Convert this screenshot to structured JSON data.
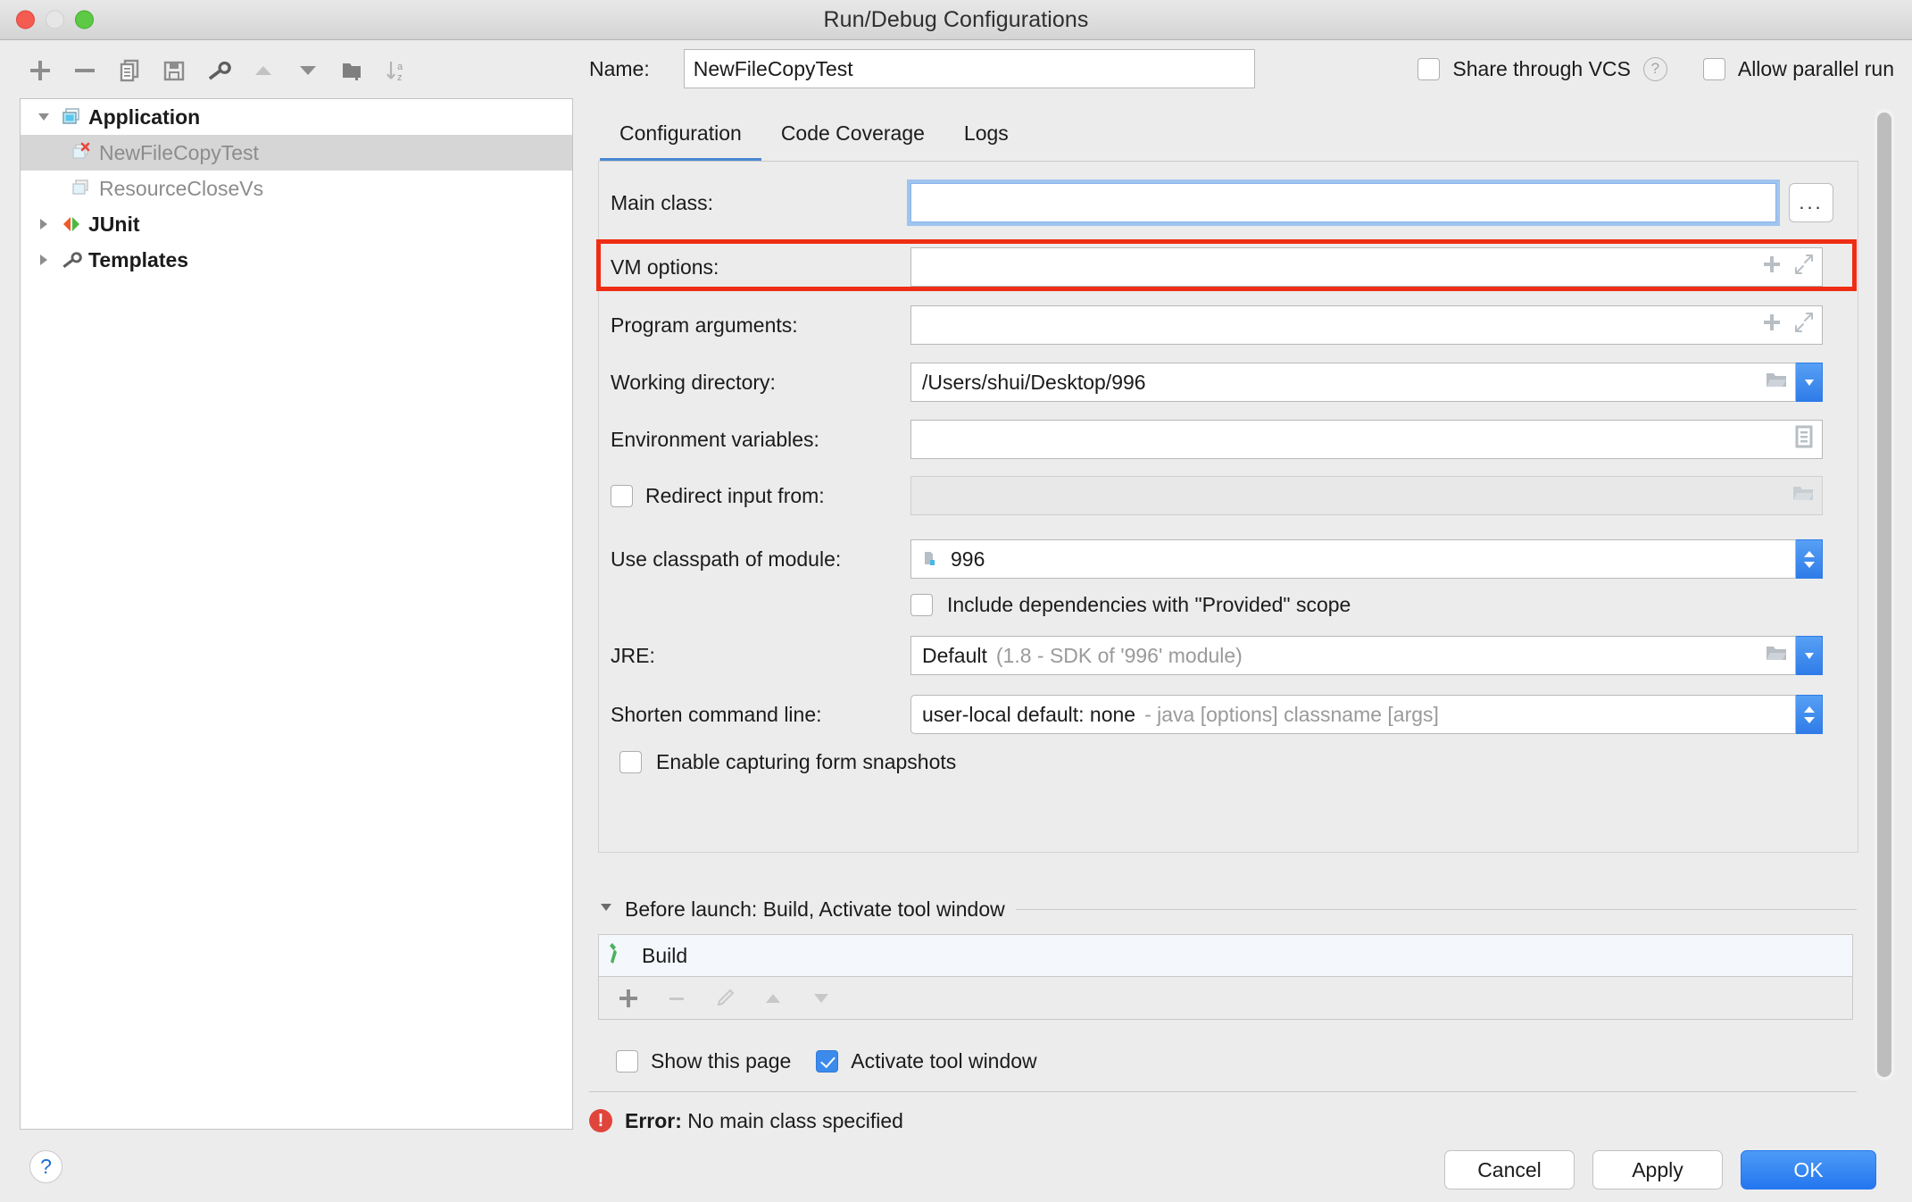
{
  "window": {
    "title": "Run/Debug Configurations"
  },
  "toolbar": {
    "items": [
      {
        "name": "add-configuration-button",
        "icon": "plus-icon"
      },
      {
        "name": "remove-configuration-button",
        "icon": "minus-icon"
      },
      {
        "name": "copy-configuration-button",
        "icon": "copy-icon"
      },
      {
        "name": "save-configuration-button",
        "icon": "save-icon"
      },
      {
        "name": "edit-templates-button",
        "icon": "wrench-icon"
      },
      {
        "name": "move-up-button",
        "icon": "triangle-up-icon"
      },
      {
        "name": "move-down-button",
        "icon": "triangle-down-icon"
      },
      {
        "name": "create-folder-button",
        "icon": "folder-add-icon"
      },
      {
        "name": "sort-configurations-button",
        "icon": "sort-az-icon"
      }
    ]
  },
  "tree": {
    "nodes": [
      {
        "label": "Application",
        "level": 0,
        "expanded": true,
        "bold": true,
        "icon": "application-icon",
        "selected": false
      },
      {
        "label": "NewFileCopyTest",
        "level": 1,
        "expanded": null,
        "bold": false,
        "icon": "config-error-icon",
        "selected": true
      },
      {
        "label": "ResourceCloseVs",
        "level": 1,
        "expanded": null,
        "bold": false,
        "icon": "config-icon",
        "selected": false
      },
      {
        "label": "JUnit",
        "level": 0,
        "expanded": false,
        "bold": true,
        "icon": "junit-icon",
        "selected": false
      },
      {
        "label": "Templates",
        "level": 0,
        "expanded": false,
        "bold": true,
        "icon": "wrench-icon",
        "selected": false
      }
    ]
  },
  "header": {
    "name_label": "Name:",
    "name_value": "NewFileCopyTest",
    "share_vcs_label": "Share through VCS",
    "share_vcs_checked": false,
    "share_vcs_help": "?",
    "allow_parallel_label": "Allow parallel run",
    "allow_parallel_checked": false
  },
  "tabs": {
    "items": [
      {
        "label": "Configuration",
        "active": true
      },
      {
        "label": "Code Coverage",
        "active": false
      },
      {
        "label": "Logs",
        "active": false
      }
    ]
  },
  "form": {
    "main_class": {
      "label": "Main class:",
      "value": "",
      "browse_button": "...",
      "focused": true
    },
    "vm_options": {
      "label": "VM options:",
      "value": "",
      "highlighted": true
    },
    "program_arguments": {
      "label": "Program arguments:",
      "value": ""
    },
    "working_directory": {
      "label": "Working directory:",
      "value": "/Users/shui/Desktop/996"
    },
    "environment_variables": {
      "label": "Environment variables:",
      "value": ""
    },
    "redirect_input": {
      "label": "Redirect input from:",
      "checked": false,
      "value": "",
      "disabled": true
    },
    "classpath_module": {
      "label": "Use classpath of module:",
      "value": "996"
    },
    "include_provided": {
      "label": "Include dependencies with \"Provided\" scope",
      "checked": false
    },
    "jre": {
      "label": "JRE:",
      "value": "Default",
      "value_hint": "(1.8 - SDK of '996' module)"
    },
    "shorten_command_line": {
      "label": "Shorten command line:",
      "value": "user-local default: none",
      "value_hint": "- java [options] classname [args]"
    },
    "form_snapshots": {
      "label": "Enable capturing form snapshots",
      "checked": false
    }
  },
  "before_launch": {
    "header": "Before launch: Build, Activate tool window",
    "tasks": [
      {
        "label": "Build",
        "icon": "build-hammer-icon"
      }
    ],
    "toolbar": [
      {
        "name": "add-task-button",
        "icon": "plus-icon",
        "enabled": true
      },
      {
        "name": "remove-task-button",
        "icon": "minus-icon",
        "enabled": false
      },
      {
        "name": "edit-task-button",
        "icon": "pencil-icon",
        "enabled": false
      },
      {
        "name": "task-move-up",
        "icon": "triangle-up-icon",
        "enabled": false
      },
      {
        "name": "task-move-down",
        "icon": "triangle-down-icon",
        "enabled": false
      }
    ],
    "show_page_label": "Show this page",
    "show_page_checked": false,
    "activate_window_label": "Activate tool window",
    "activate_window_checked": true
  },
  "status": {
    "error_prefix": "Error:",
    "error_message": "No main class specified"
  },
  "footer": {
    "help_label": "?",
    "cancel_label": "Cancel",
    "apply_label": "Apply",
    "ok_label": "OK"
  },
  "colors": {
    "accent_blue": "#2476ef",
    "focus_ring": "#9fc4f0",
    "error_red": "#e0453c",
    "annotation_red": "#ee2d14",
    "tab_underline": "#4a87d3"
  }
}
